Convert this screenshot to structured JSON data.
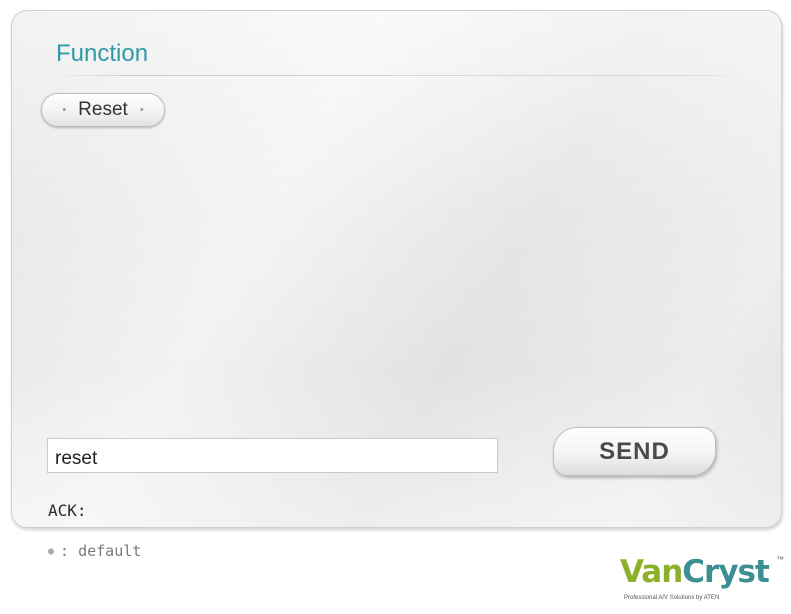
{
  "panel": {
    "title": "Function",
    "functions": [
      {
        "label": "Reset"
      }
    ]
  },
  "command": {
    "value": "reset",
    "send_label": "SEND",
    "ack_label": "ACK:"
  },
  "legend": {
    "text": ": default"
  },
  "brand": {
    "logo_van": "Van",
    "logo_cryst": "Cryst",
    "trademark": "™",
    "tagline": "Professional A/V Solutions by ATEN",
    "colors": {
      "van": "#8bb02a",
      "cryst": "#3d8f93"
    }
  },
  "colors": {
    "title": "#2f9aa8",
    "panel_background": "#e6e6e6"
  },
  "icons": {
    "button_bullet": "small-dot-icon",
    "legend_bullet": "bullet-icon"
  }
}
